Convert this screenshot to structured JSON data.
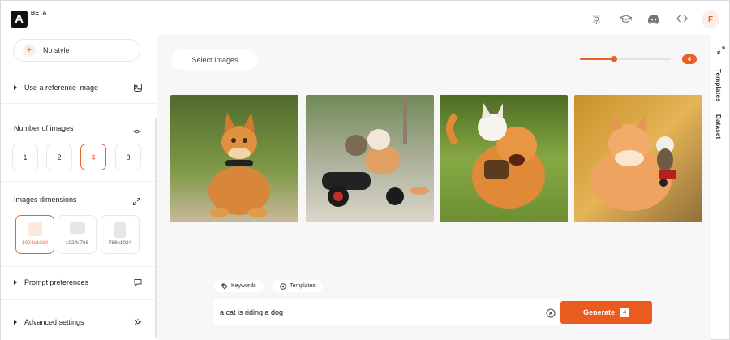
{
  "header": {
    "logo_letter": "A",
    "beta_label": "BETA",
    "icons": [
      "sun-icon",
      "graduation-cap-icon",
      "discord-icon",
      "code-icon"
    ],
    "avatar_initial": "F"
  },
  "sidebar": {
    "style_button": "No style",
    "reference_image": "Use a reference image",
    "number_of_images": {
      "label": "Number of images",
      "options": [
        "1",
        "2",
        "4",
        "8"
      ],
      "selected": "4"
    },
    "dimensions": {
      "label": "Images dimensions",
      "options": [
        "1024x1024",
        "1024x768",
        "768x1024"
      ],
      "selected": "1024x1024"
    },
    "prompt_preferences": "Prompt preferences",
    "advanced_settings": "Advanced settings"
  },
  "main": {
    "select_images_label": "Select Images",
    "slider": {
      "value": 4,
      "max": 8,
      "badge": "4"
    },
    "images": [
      {
        "alt": "Orange tabby cat sitting with a harness",
        "palette": [
          "#6b8c3e",
          "#d8893e"
        ]
      },
      {
        "alt": "Two cats riding a small scooter",
        "palette": [
          "#8b9b7a",
          "#c97e3a"
        ]
      },
      {
        "alt": "White cat riding an orange cat",
        "palette": [
          "#7ea24a",
          "#e08a38"
        ]
      },
      {
        "alt": "Fluffy cat with small kitten on a cart",
        "palette": [
          "#d49b3d",
          "#e89b54"
        ]
      }
    ],
    "chips": {
      "keywords": "Keywords",
      "templates": "Templates"
    },
    "prompt": {
      "value": "a cat is riding a dog"
    },
    "generate": {
      "label": "Generate",
      "count": "4"
    }
  },
  "right_rail": {
    "templates": "Templates",
    "dataset": "Dataset"
  },
  "colors": {
    "accent": "#e8612b",
    "generate_bg": "#ea5b1f"
  }
}
